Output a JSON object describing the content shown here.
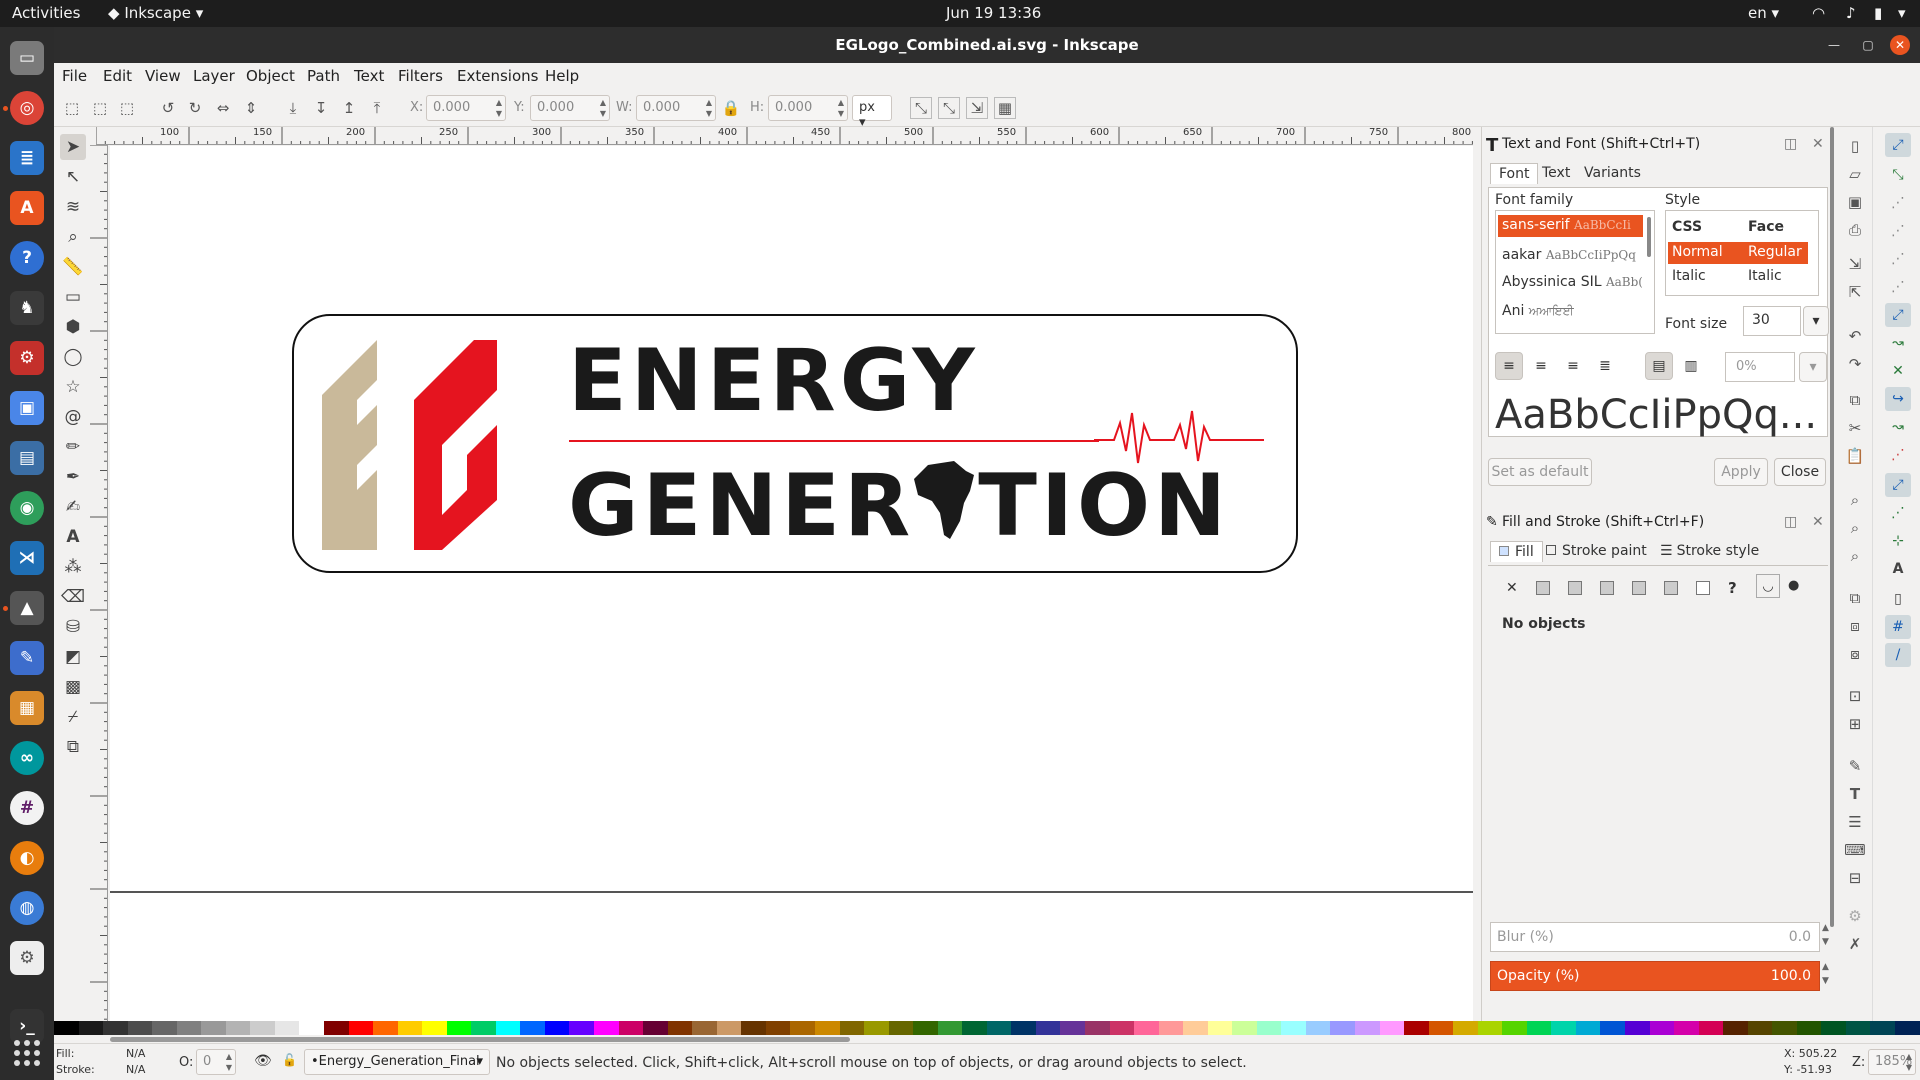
{
  "topbar": {
    "activities": "Activities",
    "app_name": "Inkscape",
    "datetime": "Jun 19  13:36",
    "language": "en"
  },
  "window": {
    "title": "EGLogo_Combined.ai.svg - Inkscape"
  },
  "menu": [
    "File",
    "Edit",
    "View",
    "Layer",
    "Object",
    "Path",
    "Text",
    "Filters",
    "Extensions",
    "Help"
  ],
  "controls": {
    "x_label": "X:",
    "x_value": "0.000",
    "y_label": "Y:",
    "y_value": "0.000",
    "w_label": "W:",
    "w_value": "0.000",
    "h_label": "H:",
    "h_value": "0.000",
    "unit": "px"
  },
  "ruler_labels": [
    "100",
    "150",
    "200",
    "250",
    "300",
    "350",
    "400",
    "450",
    "500",
    "550",
    "600",
    "650",
    "700",
    "750",
    "800"
  ],
  "logo": {
    "line1": "ENERGY",
    "line2": "GENER░TION",
    "line2_left": "GENER",
    "line2_right": "TION",
    "colors": {
      "red": "#e5141f",
      "beige": "#c9b99a",
      "black": "#1a1a1a"
    }
  },
  "text_font_panel": {
    "title": "Text and Font (Shift+Ctrl+T)",
    "tabs": [
      "Font",
      "Text",
      "Variants"
    ],
    "font_family_label": "Font family",
    "fonts": [
      {
        "name": "sans-serif",
        "sample": "AaBbCcIi"
      },
      {
        "name": "aakar",
        "sample": "AaBbCcIiPpQq"
      },
      {
        "name": "Abyssinica SIL",
        "sample": "AaBb("
      },
      {
        "name": "Ani",
        "sample": "ਅਆਇਈ"
      }
    ],
    "style_label": "Style",
    "style_headers": [
      "CSS",
      "Face"
    ],
    "styles": [
      {
        "css": "Normal",
        "face": "Regular"
      },
      {
        "css": "Italic",
        "face": "Italic"
      }
    ],
    "font_size_label": "Font size",
    "font_size": "30",
    "spacing": "0%",
    "preview": "AaBbCcIiPpQq...",
    "set_default": "Set as default",
    "apply": "Apply",
    "close": "Close"
  },
  "fill_stroke_panel": {
    "title": "Fill and Stroke (Shift+Ctrl+F)",
    "tabs": [
      "Fill",
      "Stroke paint",
      "Stroke style"
    ],
    "no_objects": "No objects",
    "blur_label": "Blur (%)",
    "blur_value": "0.0",
    "opacity_label": "Opacity (%)",
    "opacity_value": "100.0"
  },
  "status": {
    "fill_label": "Fill:",
    "fill_value": "N/A",
    "stroke_label": "Stroke:",
    "stroke_value": "N/A",
    "o_label": "O:",
    "o_value": "0",
    "layer": "•Energy_Generation_Final",
    "message": "No objects selected. Click, Shift+click, Alt+scroll mouse on top of objects, or drag around objects to select.",
    "x_coord": "X: 505.22",
    "y_coord": "Y: -51.93",
    "z_label": "Z:",
    "zoom": "185%"
  },
  "palette_colors": [
    "#000000",
    "#1a1a1a",
    "#333333",
    "#4d4d4d",
    "#666666",
    "#808080",
    "#999999",
    "#b3b3b3",
    "#cccccc",
    "#e6e6e6",
    "#ffffff",
    "#800000",
    "#ff0000",
    "#ff6600",
    "#ffcc00",
    "#ffff00",
    "#00ff00",
    "#00cc66",
    "#00ffff",
    "#0066ff",
    "#0000ff",
    "#6600ff",
    "#ff00ff",
    "#cc0066",
    "#660033",
    "#803300",
    "#996633",
    "#cc9966",
    "#663300",
    "#804000",
    "#aa6600",
    "#cc8800",
    "#806600",
    "#999900",
    "#666600",
    "#336600",
    "#339933",
    "#006633",
    "#006666",
    "#003366",
    "#333399",
    "#663399",
    "#993366",
    "#cc3366",
    "#ff6699",
    "#ff9999",
    "#ffcc99",
    "#ffff99",
    "#ccff99",
    "#99ffcc",
    "#99ffff",
    "#99ccff",
    "#9999ff",
    "#cc99ff",
    "#ff99ff",
    "#aa0000",
    "#d45500",
    "#d4aa00",
    "#aad400",
    "#55d400",
    "#00d455",
    "#00d4aa",
    "#00aad4",
    "#0055d4",
    "#5500d4",
    "#aa00d4",
    "#d400aa",
    "#d40055",
    "#552200",
    "#554400",
    "#445500",
    "#225500",
    "#005522",
    "#005544",
    "#004455",
    "#002255"
  ]
}
